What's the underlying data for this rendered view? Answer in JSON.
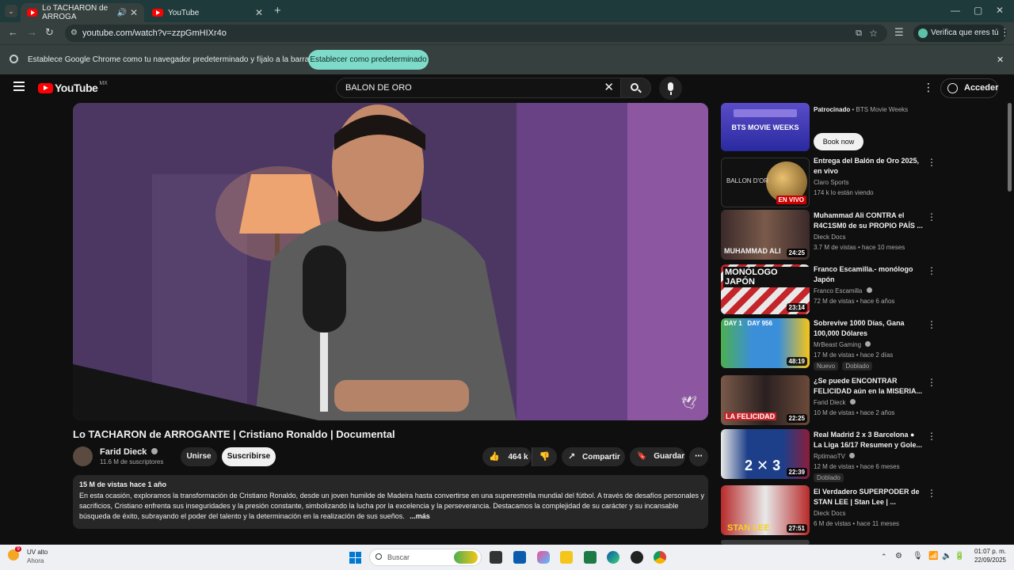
{
  "browser": {
    "tabs": [
      {
        "label": "Lo TACHARON de ARROGA"
      },
      {
        "label": "YouTube"
      }
    ],
    "url": "youtube.com/watch?v=zzpGmHIXr4o",
    "verify_label": "Verifica que eres tú",
    "infobar_text": "Establece Google Chrome como tu navegador predeterminado y fíjalo a la barra de tareas",
    "infobar_button": "Establecer como predeterminado"
  },
  "youtube": {
    "logo": "YouTube",
    "region": "MX",
    "search_value": "BALON DE ORO",
    "signin_label": "Acceder"
  },
  "video": {
    "title": "Lo TACHARON de ARROGANTE | Cristiano Ronaldo | Documental",
    "channel": "Farid Dieck",
    "subscribers": "11.6 M de suscriptores",
    "join_label": "Unirse",
    "subscribe_label": "Suscribirse",
    "likes": "464 k",
    "share_label": "Compartir",
    "save_label": "Guardar",
    "meta": "15 M de vistas  hace 1 año",
    "description": "En esta ocasión, exploramos la transformación de Cristiano Ronaldo, desde un joven humilde de Madeira hasta convertirse en una superestrella mundial del fútbol. A través de desafíos personales y sacrificios, Cristiano enfrenta sus inseguridades y la presión constante, simbolizando la lucha por la excelencia y la perseverancia. Destacamos la complejidad de su carácter y su incansable búsqueda de éxito, subrayando el poder del talento y la determinación en la realización de sus sueños.",
    "more_label": "...más"
  },
  "sidebar": {
    "ad": {
      "thumb_text": "BTS MOVIE WEEKS",
      "sponsored": "Patrocinado",
      "advertiser": "BTS Movie Weeks",
      "button": "Book now"
    },
    "items": [
      {
        "title": "Entrega del Balón de Oro 2025, en vivo",
        "channel": "Claro Sports",
        "stats": "174 k lo están viendo",
        "badge": "EN VIVO",
        "thumb_text": "BALLON D'OR",
        "color": "#1a1a1a"
      },
      {
        "title": "Muhammad Ali CONTRA el R4C1SM0 de su PROPIO PAÍS ...",
        "channel": "Dieck Docs",
        "stats": "3.7 M de vistas • hace 10 meses",
        "duration": "24:25",
        "thumb_text": "MUHAMMAD ALI",
        "color": "#6a4a3a"
      },
      {
        "title": "Franco Escamilla.- monólogo Japón",
        "channel": "Franco Escamilla",
        "stats": "72 M de vistas • hace 6 años",
        "duration": "23:14",
        "thumb_text": "MONÓLOGO JAPÓN",
        "color": "#c4242a"
      },
      {
        "title": "Sobrevive 1000 Días, Gana 100,000 Dólares",
        "channel": "MrBeast Gaming",
        "stats": "17 M de vistas • hace 2 días",
        "duration": "48:19",
        "tags": [
          "Nuevo",
          "Doblado"
        ],
        "thumb_text": "DAY 1   DAY 956",
        "color": "#3b8fd9"
      },
      {
        "title": "¿Se puede ENCONTRAR FELICIDAD aún en la MISERIA...",
        "channel": "Farid Dieck",
        "stats": "10 M de vistas • hace 2 años",
        "duration": "22:25",
        "thumb_text": "LA FELICIDAD",
        "color": "#5a4a3a"
      },
      {
        "title": "Real Madrid 2 x 3 Barcelona ● La Liga 16/17 Resumen y Gole...",
        "channel": "RptimaoTV",
        "stats": "12 M de vistas • hace 6 meses",
        "duration": "22:39",
        "tags": [
          "Doblado"
        ],
        "thumb_text": "2 ✕ 3",
        "color": "#1d3f8a"
      },
      {
        "title": "El Verdadero SUPERPODER de STAN LEE | Stan Lee | ...",
        "channel": "Dieck Docs",
        "stats": "6 M de vistas • hace 11 meses",
        "duration": "27:51",
        "thumb_text": "STAN LEE",
        "color": "#8a2a2a"
      }
    ]
  },
  "taskbar": {
    "weather_temp": "9",
    "weather_label": "UV alto",
    "weather_sub": "Ahora",
    "search_placeholder": "Buscar",
    "time": "01:07 p. m.",
    "date": "22/09/2025"
  }
}
